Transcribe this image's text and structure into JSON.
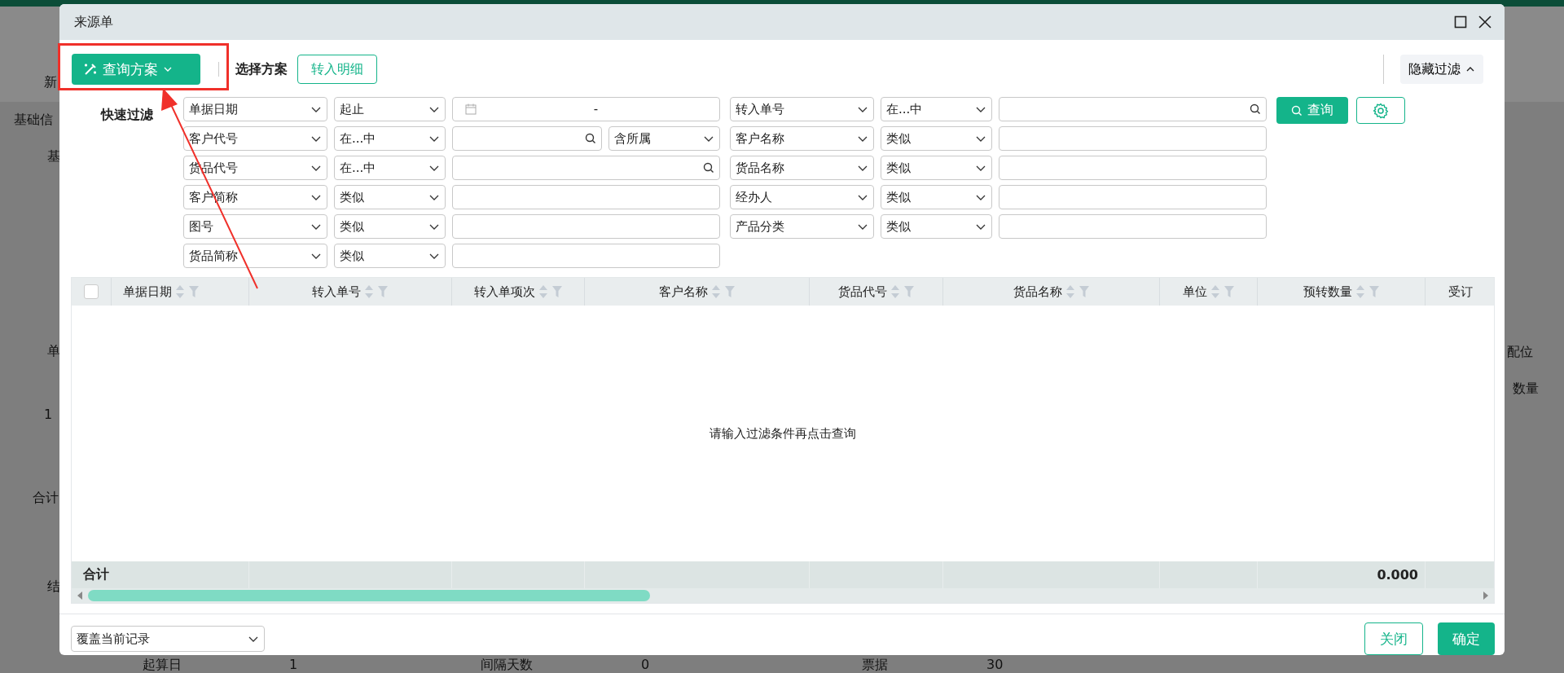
{
  "background": {
    "fragments": [
      {
        "text": "新"
      },
      {
        "text": "基础信"
      },
      {
        "text": "基"
      },
      {
        "text": "单"
      },
      {
        "text": "1"
      },
      {
        "text": "合计"
      },
      {
        "text": "结"
      },
      {
        "text": "配位"
      },
      {
        "text": "数量"
      },
      {
        "text": "起算日"
      },
      {
        "text": "1"
      },
      {
        "text": "间隔天数"
      },
      {
        "text": "0"
      },
      {
        "text": "票据"
      },
      {
        "text": "30"
      }
    ]
  },
  "dialog": {
    "title": "来源单"
  },
  "toolbar": {
    "scheme_button": "查询方案",
    "scheme_label": "选择方案",
    "detail_button": "转入明细",
    "hide_filter_button": "隐藏过滤"
  },
  "quick_filter": {
    "label": "快速过滤",
    "search_button": "查询",
    "rows": [
      {
        "groups": [
          {
            "field": "单据日期",
            "operator": "起止",
            "kind": "date",
            "separator": "-"
          },
          {
            "field": "转入单号",
            "operator": "在...中",
            "kind": "lookup"
          }
        ]
      },
      {
        "groups": [
          {
            "field": "客户代号",
            "operator": "在...中",
            "kind": "lookup",
            "scope": "含所属"
          },
          {
            "field": "客户名称",
            "operator": "类似",
            "kind": "text"
          }
        ]
      },
      {
        "groups": [
          {
            "field": "货品代号",
            "operator": "在...中",
            "kind": "lookup"
          },
          {
            "field": "货品名称",
            "operator": "类似",
            "kind": "text"
          }
        ]
      },
      {
        "groups": [
          {
            "field": "客户简称",
            "operator": "类似",
            "kind": "text"
          },
          {
            "field": "经办人",
            "operator": "类似",
            "kind": "text"
          }
        ]
      },
      {
        "groups": [
          {
            "field": "图号",
            "operator": "类似",
            "kind": "text"
          },
          {
            "field": "产品分类",
            "operator": "类似",
            "kind": "text"
          }
        ]
      },
      {
        "groups": [
          {
            "field": "货品简称",
            "operator": "类似",
            "kind": "text"
          }
        ]
      }
    ]
  },
  "table": {
    "select_all": {
      "checked": false
    },
    "columns": [
      {
        "label": "单据日期",
        "kind": "date",
        "sortable": true
      },
      {
        "label": "转入单号",
        "kind": "text",
        "sortable": true
      },
      {
        "label": "转入单项次",
        "kind": "text",
        "sortable": true
      },
      {
        "label": "客户名称",
        "kind": "text",
        "sortable": true
      },
      {
        "label": "货品代号",
        "kind": "text",
        "sortable": true
      },
      {
        "label": "货品名称",
        "kind": "text",
        "sortable": true
      },
      {
        "label": "单位",
        "kind": "text",
        "sortable": true
      },
      {
        "label": "预转数量",
        "kind": "quantity",
        "sortable": true
      },
      {
        "label": "受订",
        "kind": "text",
        "sortable": false
      }
    ],
    "empty_message": "请输入过滤条件再点击查询",
    "totals": {
      "label": "合计",
      "amount": "0.000"
    }
  },
  "footer": {
    "mode_select": "覆盖当前记录",
    "close_button": "关闭",
    "confirm_button": "确定"
  }
}
